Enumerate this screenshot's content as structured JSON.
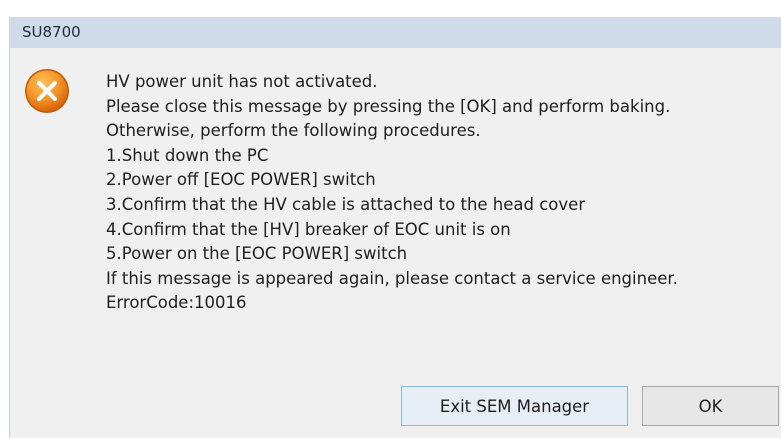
{
  "window": {
    "title": "SU8700"
  },
  "dialog": {
    "icon": "error-x-icon",
    "message_lines": [
      "HV power unit has not activated.",
      "Please close this message by pressing the [OK] and perform baking.",
      "Otherwise, perform the following procedures.",
      "1.Shut down the PC",
      "2.Power off [EOC POWER] switch",
      "3.Confirm that the HV cable is attached to the head cover",
      "4.Confirm that the [HV] breaker of EOC unit is on",
      "5.Power on the [EOC POWER] switch",
      "If this message is appeared again, please contact a service engineer.",
      "ErrorCode:10016"
    ]
  },
  "buttons": {
    "exit_label": "Exit SEM Manager",
    "ok_label": "OK"
  },
  "colors": {
    "titlebar": "#cfdaea",
    "dialog_bg": "#f0f0f0",
    "icon_orange": "#f08a1c"
  }
}
